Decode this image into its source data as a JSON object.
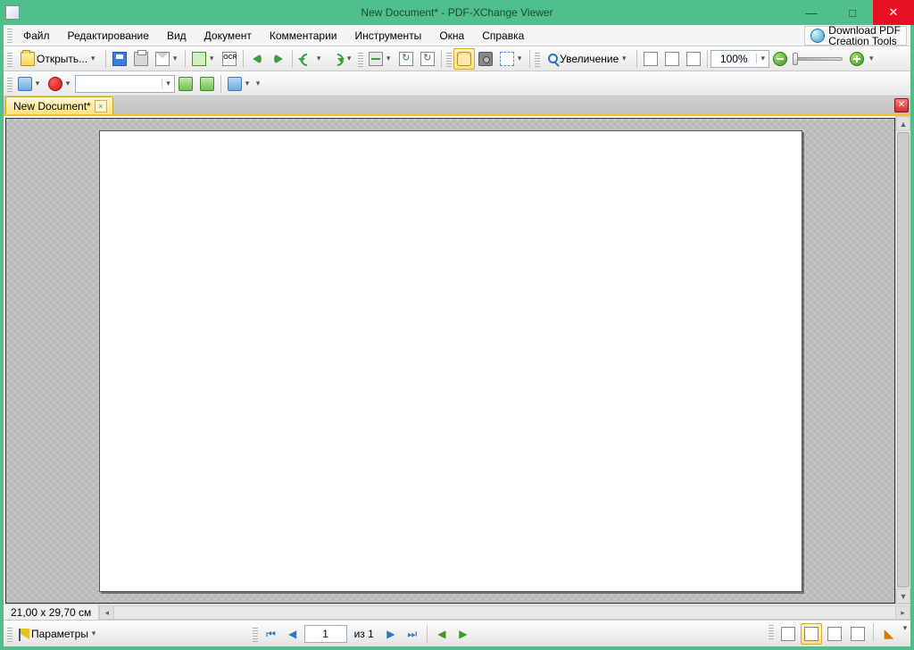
{
  "window": {
    "title": "New Document* - PDF-XChange Viewer",
    "minimize": "—",
    "maximize": "□",
    "close": "✕"
  },
  "menu": {
    "file": "Файл",
    "edit": "Редактирование",
    "view": "Вид",
    "document": "Документ",
    "comments": "Комментарии",
    "tools": "Инструменты",
    "windows": "Окна",
    "help": "Справка",
    "promo_line1": "Download PDF",
    "promo_line2": "Creation Tools"
  },
  "toolbar1": {
    "open_label": "Открыть...",
    "zoom_label": "Увеличение",
    "zoom_value": "100%"
  },
  "toolbar2": {
    "find_value": ""
  },
  "tabs": {
    "doc1": "New Document*"
  },
  "status": {
    "dimensions": "21,00 x 29,70 см"
  },
  "bottom": {
    "options_label": "Параметры",
    "page_current": "1",
    "page_of_prefix": "из",
    "page_total": "1"
  }
}
